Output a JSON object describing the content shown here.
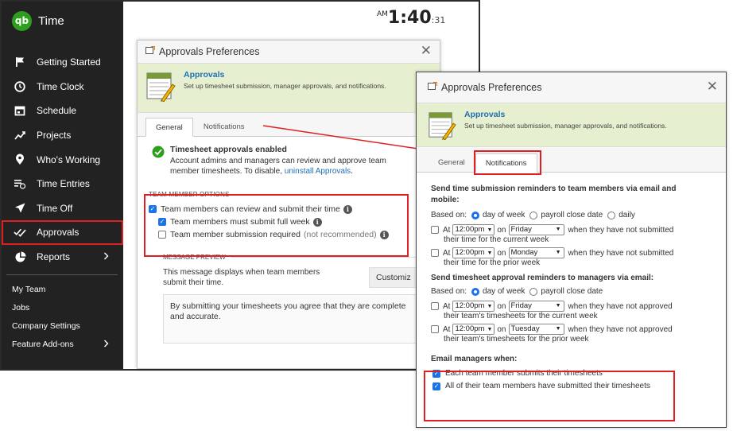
{
  "app": {
    "logo_text": "qb",
    "title": "Time"
  },
  "clock": {
    "ampm": "AM",
    "time": "1:40",
    "seconds": ":31"
  },
  "sidebar": {
    "items": [
      {
        "label": "Getting Started",
        "icon": "flag-icon"
      },
      {
        "label": "Time Clock",
        "icon": "clock-icon"
      },
      {
        "label": "Schedule",
        "icon": "calendar-icon"
      },
      {
        "label": "Projects",
        "icon": "chart-trend-icon"
      },
      {
        "label": "Who's Working",
        "icon": "location-pin-icon"
      },
      {
        "label": "Time Entries",
        "icon": "list-clock-icon"
      },
      {
        "label": "Time Off",
        "icon": "airplane-icon"
      },
      {
        "label": "Approvals",
        "icon": "checkmarks-icon"
      },
      {
        "label": "Reports",
        "icon": "pie-chart-icon"
      }
    ],
    "sub_items": [
      {
        "label": "My Team"
      },
      {
        "label": "Jobs"
      },
      {
        "label": "Company Settings"
      },
      {
        "label": "Feature Add-ons"
      }
    ]
  },
  "modal1": {
    "title": "Approvals Preferences",
    "banner_title": "Approvals",
    "banner_subtitle": "Set up timesheet submission, manager approvals, and notifications.",
    "tabs": [
      {
        "label": "General"
      },
      {
        "label": "Notifications"
      }
    ],
    "status_title": "Timesheet approvals enabled",
    "status_text": "Account admins and managers can review and approve team member timesheets. To disable,",
    "status_link": "uninstall Approvals",
    "status_end": ".",
    "options_header": "TEAM MEMBER OPTIONS",
    "opt1": "Team members can review and submit their time",
    "opt2": "Team members must submit full week",
    "opt3": "Team member submission required",
    "opt3_note": "(not recommended)",
    "preview_header": "MESSAGE PREVIEW",
    "preview_text": "This message displays when team members submit their time.",
    "customize_label": "Customiz",
    "preview_body": "By submitting your timesheets you agree that they are complete and accurate."
  },
  "modal2": {
    "title": "Approvals Preferences",
    "banner_title": "Approvals",
    "banner_subtitle": "Set up timesheet submission, manager approvals, and notifications.",
    "tabs": [
      {
        "label": "General"
      },
      {
        "label": "Notifications"
      }
    ],
    "section1_title": "Send time submission reminders to team members via email and mobile:",
    "based_on": "Based on:",
    "r_day": "day of week",
    "r_payroll": "payroll close date",
    "r_daily": "daily",
    "at": "At",
    "on": "on",
    "time1": "12:00pm",
    "day1": "Friday",
    "rem1_a": "when they have not submitted",
    "rem1_b": "their time for the current week",
    "time2": "12:00pm",
    "day2": "Monday",
    "rem2_a": "when they have not submitted",
    "rem2_b": "their time for the prior week",
    "section2_title": "Send timesheet approval reminders to managers via email:",
    "time3": "12:00pm",
    "day3": "Friday",
    "rem3_a": "when they have not approved",
    "rem3_b": "their team's timesheets for the current week",
    "time4": "12:00pm",
    "day4": "Tuesday",
    "rem4_a": "when they have not approved",
    "rem4_b": "their team's timesheets for the prior week",
    "email_title": "Email managers when:",
    "email1": "Each team member submits their timesheets",
    "email2": "All of their team members have submitted their timesheets"
  },
  "colors": {
    "accent": "#1a73e8",
    "highlight": "#e02020",
    "brand": "#2ca01c",
    "banner": "#e6f0d0",
    "link": "#1e6fb4"
  }
}
